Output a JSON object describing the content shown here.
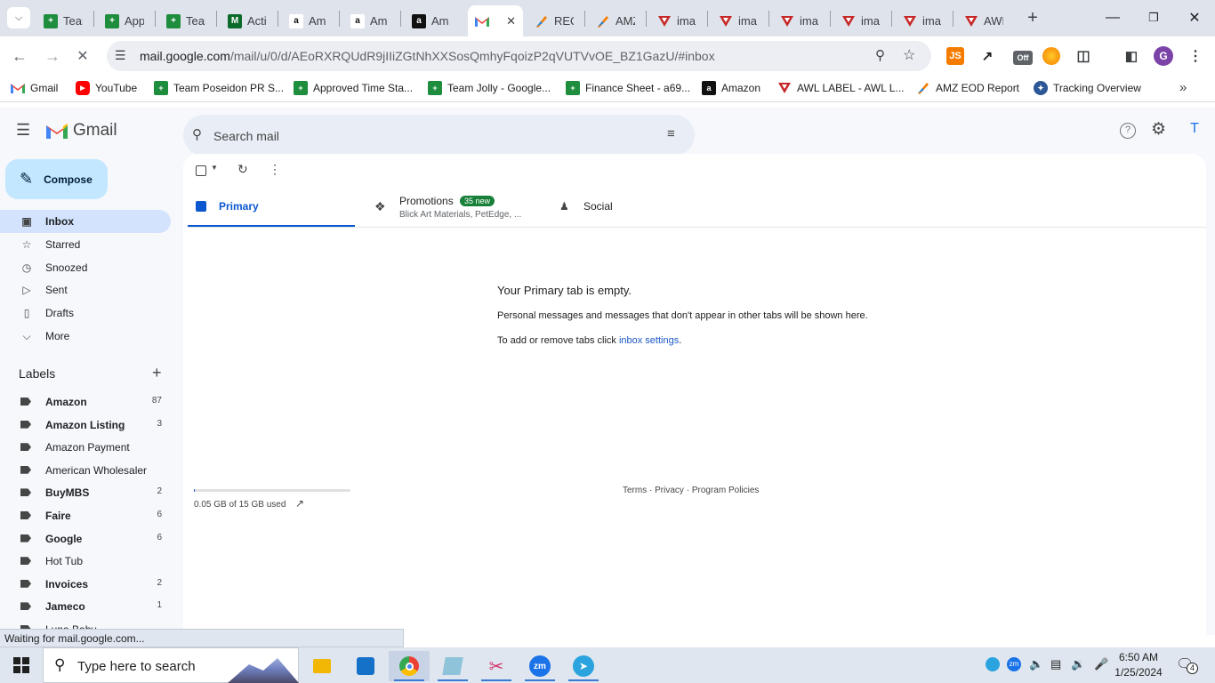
{
  "browser": {
    "tabs": [
      {
        "title": "Tear",
        "icon": "sheets-icon",
        "color": "#1e8e3e"
      },
      {
        "title": "App",
        "icon": "sheets-icon",
        "color": "#1e8e3e"
      },
      {
        "title": "Tear",
        "icon": "sheets-icon",
        "color": "#1e8e3e"
      },
      {
        "title": "Acti",
        "icon": "m-icon",
        "color": "#0b6b2a"
      },
      {
        "title": "Am",
        "icon": "amazon-icon",
        "color": "#ffffff"
      },
      {
        "title": "Am",
        "icon": "amazon-icon",
        "color": "#ffffff"
      },
      {
        "title": "Am",
        "icon": "amazon-icon",
        "color": "#111111"
      },
      {
        "title": "",
        "icon": "gmail-icon",
        "color": "#ffffff"
      },
      {
        "title": "REQ",
        "icon": "pen-icon",
        "color": "#f57c00"
      },
      {
        "title": "AMZ",
        "icon": "pen-icon",
        "color": "#f57c00"
      },
      {
        "title": "ima",
        "icon": "awl-icon",
        "color": "#c62828"
      },
      {
        "title": "ima",
        "icon": "awl-icon",
        "color": "#c62828"
      },
      {
        "title": "ima",
        "icon": "awl-icon",
        "color": "#c62828"
      },
      {
        "title": "ima",
        "icon": "awl-icon",
        "color": "#c62828"
      },
      {
        "title": "ima",
        "icon": "awl-icon",
        "color": "#c62828"
      },
      {
        "title": "AWL",
        "icon": "awl-icon",
        "color": "#c62828"
      }
    ],
    "url_domain": "mail.google.com",
    "url_path": "/mail/u/0/d/AEoRXRQUdR9jIIiZGtNhXXSosQmhyFqoizP2qVUTVvOE_BZ1GazU/#inbox",
    "profile_initial": "G",
    "ext_js_label": "JS",
    "ext_off_label": "Off",
    "bookmarks": [
      {
        "label": "Gmail",
        "icon": "gmail-icon"
      },
      {
        "label": "YouTube",
        "icon": "youtube-icon"
      },
      {
        "label": "Team Poseidon PR S...",
        "icon": "sheets-icon"
      },
      {
        "label": "Approved Time Sta...",
        "icon": "sheets-icon"
      },
      {
        "label": "Team Jolly - Google...",
        "icon": "sheets-icon"
      },
      {
        "label": "Finance Sheet - a69...",
        "icon": "sheets-icon"
      },
      {
        "label": "Amazon",
        "icon": "amazon-icon"
      },
      {
        "label": "AWL LABEL - AWL L...",
        "icon": "awl-icon"
      },
      {
        "label": "AMZ EOD Report",
        "icon": "pen-icon"
      },
      {
        "label": "Tracking Overview",
        "icon": "tracking-icon"
      }
    ],
    "status_text": "Waiting for mail.google.com..."
  },
  "gmail": {
    "logo_text": "Gmail",
    "search_placeholder": "Search mail",
    "compose_label": "Compose",
    "account_initial": "T",
    "nav": [
      {
        "label": "Inbox",
        "icon": "inbox-icon",
        "selected": true
      },
      {
        "label": "Starred",
        "icon": "star-icon"
      },
      {
        "label": "Snoozed",
        "icon": "clock-icon"
      },
      {
        "label": "Sent",
        "icon": "send-icon"
      },
      {
        "label": "Drafts",
        "icon": "draft-icon"
      },
      {
        "label": "More",
        "icon": "chevron-down-icon"
      }
    ],
    "labels_heading": "Labels",
    "labels": [
      {
        "name": "Amazon",
        "count": "87",
        "bold": true
      },
      {
        "name": "Amazon Listing",
        "count": "3",
        "bold": true
      },
      {
        "name": "Amazon Payment",
        "count": "",
        "bold": false
      },
      {
        "name": "American Wholesaler",
        "count": "",
        "bold": false
      },
      {
        "name": "BuyMBS",
        "count": "2",
        "bold": true
      },
      {
        "name": "Faire",
        "count": "6",
        "bold": true
      },
      {
        "name": "Google",
        "count": "6",
        "bold": true
      },
      {
        "name": "Hot Tub",
        "count": "",
        "bold": false
      },
      {
        "name": "Invoices",
        "count": "2",
        "bold": true
      },
      {
        "name": "Jameco",
        "count": "1",
        "bold": true
      },
      {
        "name": "Luna Baby",
        "count": "",
        "bold": false
      }
    ],
    "tabs": [
      {
        "label": "Primary",
        "icon": "inbox-icon",
        "selected": true
      },
      {
        "label": "Promotions",
        "badge": "35 new",
        "sub": "Blick Art Materials, PetEdge, ...",
        "icon": "tag-icon"
      },
      {
        "label": "Social",
        "icon": "people-icon"
      }
    ],
    "empty_title": "Your Primary tab is empty.",
    "empty_line1": "Personal messages and messages that don't appear in other tabs will be shown here.",
    "empty_line2_prefix": "To add or remove tabs click ",
    "empty_line2_link": "inbox settings",
    "empty_line2_suffix": ".",
    "storage_text": "0.05 GB of 15 GB used",
    "storage_fraction": 0.0033,
    "footer_terms": "Terms",
    "footer_sep": "·",
    "footer_privacy": "Privacy",
    "footer_policies": "Program Policies"
  },
  "taskbar": {
    "search_placeholder": "Type here to search",
    "time": "6:50 AM",
    "date": "1/25/2024",
    "notification_count": "4"
  }
}
